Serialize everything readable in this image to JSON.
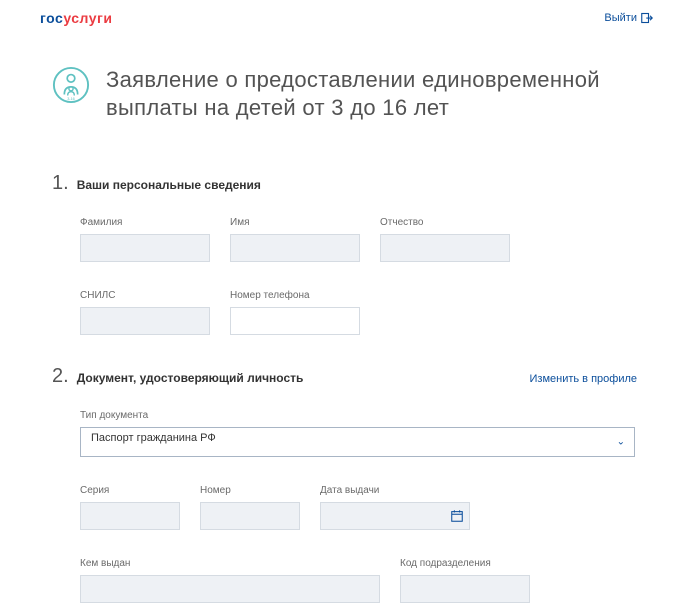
{
  "header": {
    "logo_part1": "гос",
    "logo_part2": "услуги",
    "logout": "Выйти"
  },
  "title": "Заявление о предоставлении единовременной выплаты на детей от 3 до 16 лет",
  "section1": {
    "num": "1.",
    "title": "Ваши персональные сведения",
    "fields": {
      "lastname_label": "Фамилия",
      "lastname_value": "",
      "firstname_label": "Имя",
      "firstname_value": "",
      "patronymic_label": "Отчество",
      "patronymic_value": "",
      "snils_label": "СНИЛС",
      "snils_value": "",
      "phone_label": "Номер телефона",
      "phone_value": ""
    }
  },
  "section2": {
    "num": "2.",
    "title": "Документ, удостоверяющий личность",
    "link": "Изменить в профиле",
    "fields": {
      "doctype_label": "Тип документа",
      "doctype_value": "Паспорт гражданина РФ",
      "series_label": "Серия",
      "series_value": "",
      "number_label": "Номер",
      "number_value": "",
      "issuedate_label": "Дата выдачи",
      "issuedate_value": "",
      "issuer_label": "Кем выдан",
      "issuer_value": "",
      "divcode_label": "Код подразделения",
      "divcode_value": ""
    }
  }
}
